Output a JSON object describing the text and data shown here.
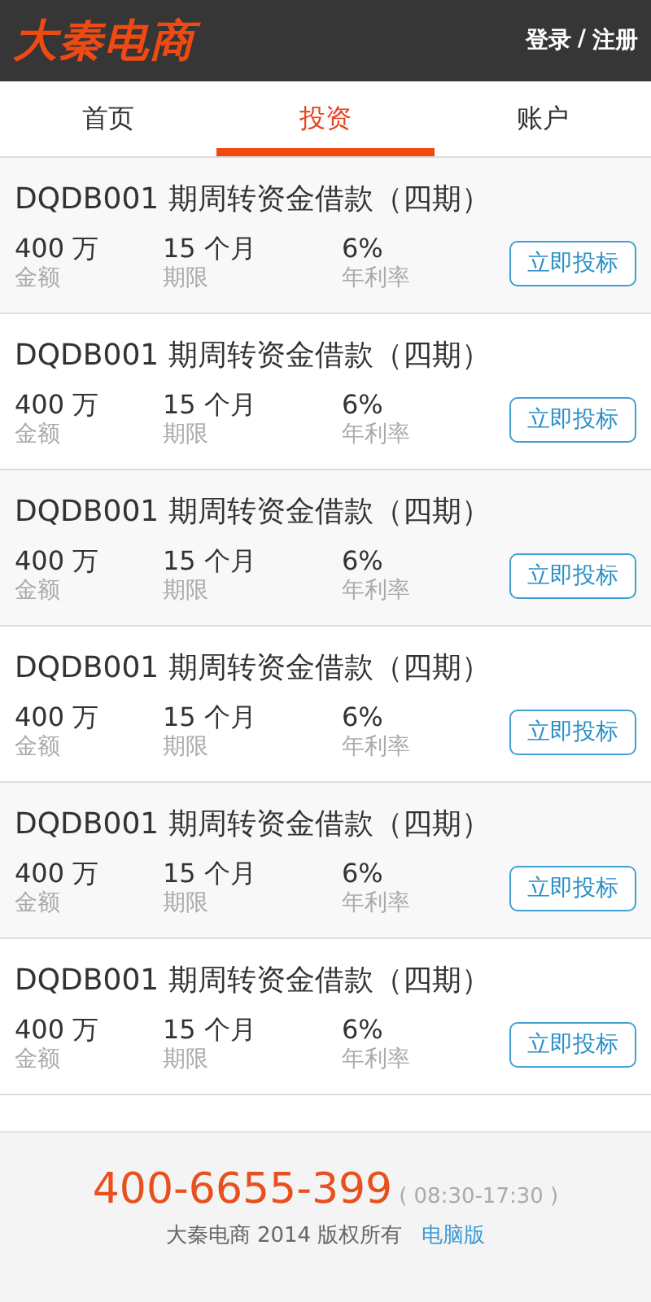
{
  "header": {
    "logo": "大秦电商",
    "login": "登录",
    "separator": "/",
    "register": "注册"
  },
  "tabs": [
    {
      "label": "首页",
      "selected": false
    },
    {
      "label": "投资",
      "selected": true
    },
    {
      "label": "账户",
      "selected": false
    }
  ],
  "loans": [
    {
      "title": "DQDB001 期周转资金借款（四期）",
      "amount": "400 万",
      "amount_label": "金额",
      "term": "15 个月",
      "term_label": "期限",
      "rate": "6%",
      "rate_label": "年利率",
      "button": "立即投标"
    },
    {
      "title": "DQDB001 期周转资金借款（四期）",
      "amount": "400 万",
      "amount_label": "金额",
      "term": "15 个月",
      "term_label": "期限",
      "rate": "6%",
      "rate_label": "年利率",
      "button": "立即投标"
    },
    {
      "title": "DQDB001 期周转资金借款（四期）",
      "amount": "400 万",
      "amount_label": "金额",
      "term": "15 个月",
      "term_label": "期限",
      "rate": "6%",
      "rate_label": "年利率",
      "button": "立即投标"
    },
    {
      "title": "DQDB001 期周转资金借款（四期）",
      "amount": "400 万",
      "amount_label": "金额",
      "term": "15 个月",
      "term_label": "期限",
      "rate": "6%",
      "rate_label": "年利率",
      "button": "立即投标"
    },
    {
      "title": "DQDB001 期周转资金借款（四期）",
      "amount": "400 万",
      "amount_label": "金额",
      "term": "15 个月",
      "term_label": "期限",
      "rate": "6%",
      "rate_label": "年利率",
      "button": "立即投标"
    },
    {
      "title": "DQDB001 期周转资金借款（四期）",
      "amount": "400 万",
      "amount_label": "金额",
      "term": "15 个月",
      "term_label": "期限",
      "rate": "6%",
      "rate_label": "年利率",
      "button": "立即投标"
    }
  ],
  "footer": {
    "phone": "400-6655-399",
    "hours": "( 08:30-17:30 )",
    "copyright": "大秦电商 2014 版权所有",
    "desktop_link": "电脑版"
  }
}
